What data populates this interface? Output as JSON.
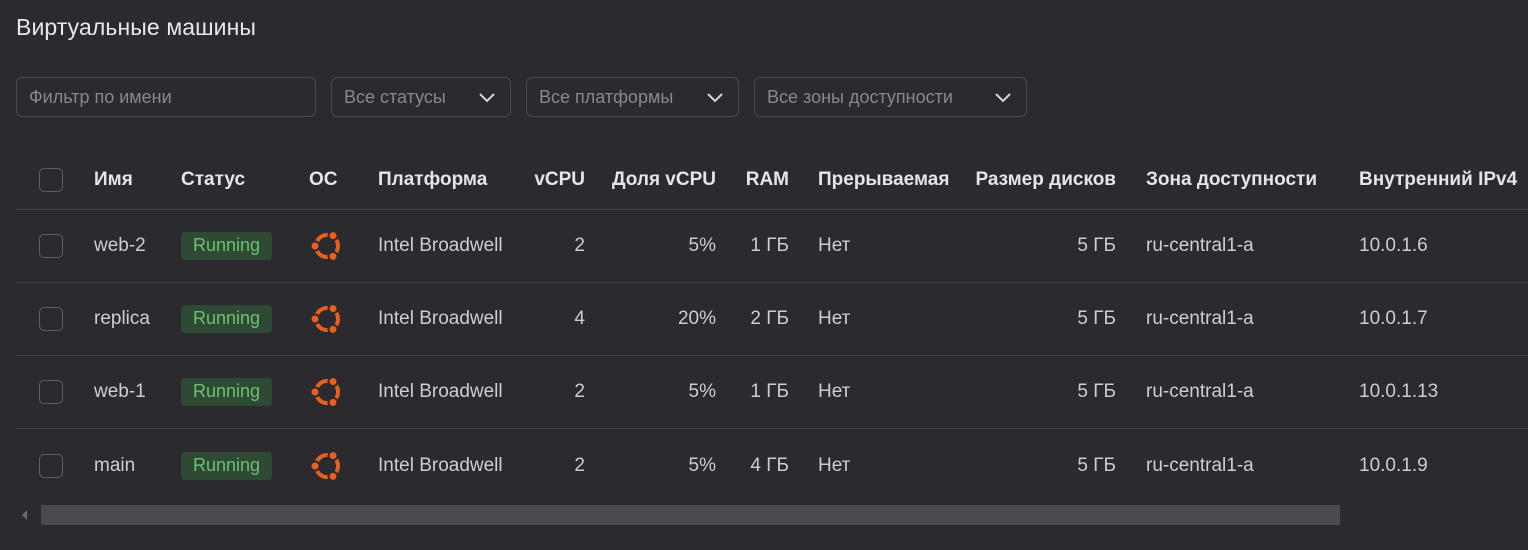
{
  "page": {
    "title": "Виртуальные машины"
  },
  "filters": {
    "name_placeholder": "Фильтр по имени",
    "status_label": "Все статусы",
    "platform_label": "Все платформы",
    "zone_label": "Все зоны доступности"
  },
  "table": {
    "headers": {
      "name": "Имя",
      "status": "Статус",
      "os": "ОС",
      "platform": "Платформа",
      "vcpu": "vCPU",
      "vcpu_share": "Доля vCPU",
      "ram": "RAM",
      "preemptible": "Прерываемая",
      "disk_size": "Размер дисков",
      "zone": "Зона доступности",
      "internal_ip": "Внутренний IPv4"
    },
    "rows": [
      {
        "name": "web-2",
        "status": "Running",
        "os_icon": "ubuntu-icon",
        "platform": "Intel Broadwell",
        "vcpu": "2",
        "vcpu_share": "5%",
        "ram": "1 ГБ",
        "preemptible": "Нет",
        "disk_size": "5 ГБ",
        "zone": "ru-central1-a",
        "internal_ip": "10.0.1.6"
      },
      {
        "name": "replica",
        "status": "Running",
        "os_icon": "ubuntu-icon",
        "platform": "Intel Broadwell",
        "vcpu": "4",
        "vcpu_share": "20%",
        "ram": "2 ГБ",
        "preemptible": "Нет",
        "disk_size": "5 ГБ",
        "zone": "ru-central1-a",
        "internal_ip": "10.0.1.7"
      },
      {
        "name": "web-1",
        "status": "Running",
        "os_icon": "ubuntu-icon",
        "platform": "Intel Broadwell",
        "vcpu": "2",
        "vcpu_share": "5%",
        "ram": "1 ГБ",
        "preemptible": "Нет",
        "disk_size": "5 ГБ",
        "zone": "ru-central1-a",
        "internal_ip": "10.0.1.13"
      },
      {
        "name": "main",
        "status": "Running",
        "os_icon": "ubuntu-icon",
        "platform": "Intel Broadwell",
        "vcpu": "2",
        "vcpu_share": "5%",
        "ram": "4 ГБ",
        "preemptible": "Нет",
        "disk_size": "5 ГБ",
        "zone": "ru-central1-a",
        "internal_ip": "10.0.1.9"
      }
    ]
  },
  "colors": {
    "background": "#2b2a2e",
    "running_badge_bg": "#2f4a34",
    "running_badge_text": "#6bc16f",
    "ubuntu_orange": "#e9601e"
  }
}
